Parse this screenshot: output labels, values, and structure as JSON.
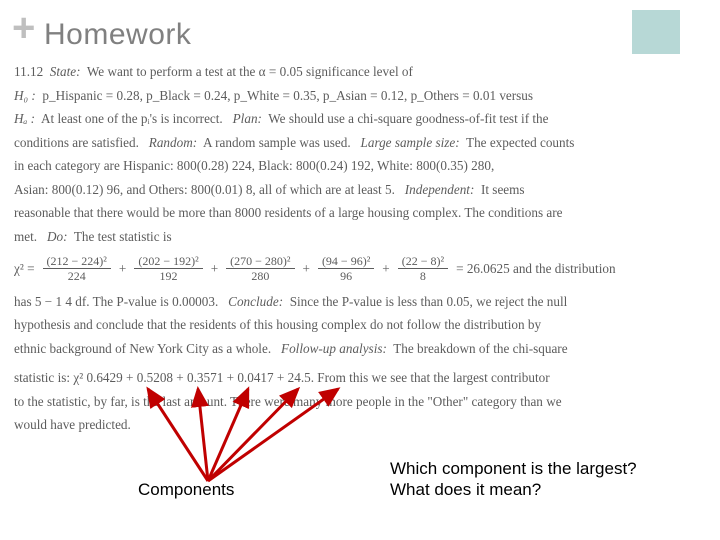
{
  "header": {
    "plus": "+",
    "title": "Homework"
  },
  "body": {
    "line1_prefix": "11.12",
    "line1_state": "State:",
    "line1_text": "We want to perform a test at the  α = 0.05 significance level of",
    "h0_label": "H₀ :",
    "h0_parts": "p_Hispanic = 0.28,  p_Black = 0.24,  p_White = 0.35,  p_Asian = 0.12,  p_Others = 0.01 versus",
    "ha_label": "Hₐ :",
    "ha_text": "At least one of the pᵢ's is incorrect.",
    "plan_label": "Plan:",
    "plan_text": "We should use a chi-square goodness-of-fit test if the",
    "cond1": "conditions are satisfied.",
    "random_label": "Random:",
    "random_text": "A random sample was used.",
    "large_label": "Large sample size:",
    "large_text": "The expected counts",
    "expected1": "in each category are Hispanic:  800(0.28)   224,  Black:  800(0.24)   192,  White:  800(0.35)   280,",
    "expected2": "Asian:  800(0.12)   96,  and Others:  800(0.01)   8,  all of which are at least 5.",
    "indep_label": "Independent:",
    "indep_text": "It seems",
    "indep2": "reasonable that there would be more than 8000 residents of a large housing complex.  The conditions are",
    "indep3": "met.",
    "do_label": "Do:",
    "do_text": "The test statistic is",
    "chi_lhs": "χ² =",
    "frac1_num": "(212 − 224)²",
    "frac1_den": "224",
    "frac2_num": "(202 − 192)²",
    "frac2_den": "192",
    "frac3_num": "(270 − 280)²",
    "frac3_den": "280",
    "frac4_num": "(94 − 96)²",
    "frac4_den": "96",
    "frac5_num": "(22 − 8)²",
    "frac5_den": "8",
    "chi_result": "= 26.0625  and the distribution",
    "df_text": "has 5 − 1    4 df.  The P-value is 0.00003.",
    "conclude_label": "Conclude:",
    "conclude_text": "Since the P-value is less than 0.05, we reject the null",
    "conclude2": "hypothesis and conclude that the residents of this housing complex do not follow the distribution by",
    "conclude3": "ethnic background of New York City as a whole.",
    "followup_label": "Follow-up analysis:",
    "followup_text": "The breakdown of the chi-square",
    "stat_line": "statistic is:   χ²    0.6429 + 0.5208 + 0.3571 + 0.0417 + 24.5.   From this we see that the largest contributor",
    "stat_line2": "to the statistic, by far, is the last amount.  There were many more people in the \"Other\" category than we",
    "stat_line3": "would have predicted."
  },
  "annotations": {
    "components": "Components",
    "question": "Which component is the largest?\nWhat does it mean?"
  }
}
